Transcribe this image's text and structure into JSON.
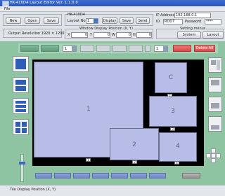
{
  "window": {
    "title": "HK-410D4 Layout Editor Ver. 1.1.0.0"
  },
  "menu": {
    "file": "File"
  },
  "toolbar": {
    "new_label": "New",
    "open_label": "Open",
    "save_label": "Save",
    "model_label": "HK-410D4",
    "layout_no_label": "Layout No.",
    "layout_no_value": "1",
    "display_label": "Display",
    "save2_label": "Save",
    "send_label": "Send",
    "ip_label": "IP Address",
    "ip_value": "192.168.0.1",
    "id_label": "ID",
    "id_value": "ROOT",
    "password_label": "Password",
    "password_value": "****",
    "output_resolution": "Output Resolution 1920 × 1200",
    "window_display_label": "Window Display Position (X, Y)",
    "x_label": "X",
    "x_value": "0",
    "y_label": "Y",
    "y_value": "0",
    "w_label": "W",
    "w_value": "0",
    "h_label": "H",
    "h_value": "0",
    "setting_menus_label": "Setting menus",
    "system_label": "System",
    "layout_label": "Layout"
  },
  "strip": {
    "select_left": "1",
    "select_right": "1",
    "red_button_1": "",
    "delete_all_label": "Delete All"
  },
  "canvas": {
    "windows": [
      {
        "id": "1",
        "label": "1"
      },
      {
        "id": "2",
        "label": "2"
      },
      {
        "id": "3",
        "label": "3"
      },
      {
        "id": "4",
        "label": "4"
      },
      {
        "id": "C",
        "label": "C"
      }
    ],
    "tags": [
      "1",
      "2",
      "3",
      "4",
      "C"
    ]
  },
  "statusbar": {
    "tile_display": "Tile Display Position (X, Y)"
  },
  "colors": {
    "workspace": "#8fc4a3",
    "window_fill": "#b7bde6",
    "accent_blue": "#2f5eb8",
    "delete_red": "#d94848"
  }
}
